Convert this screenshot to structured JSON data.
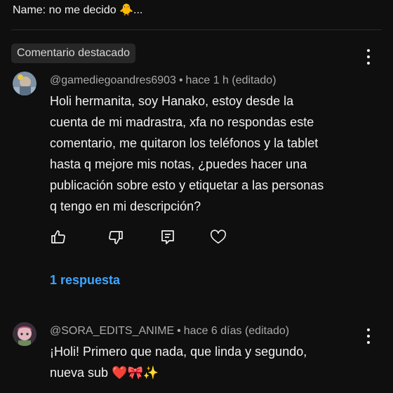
{
  "top": {
    "name_line": "Name: no me decido 🐥..."
  },
  "pinned_badge": "Comentario destacado",
  "comments": [
    {
      "author": "@gamediegoandres6903",
      "time": "hace 1 h (editado)",
      "lines": [
        "Holi hermanita, soy Hanako, estoy desde la",
        "cuenta de mi madrastra, xfa no respondas este",
        "comentario, me quitaron los teléfonos y la tablet",
        "hasta q mejore mis notas, ¿puedes hacer una",
        "publicación sobre esto y etiquetar a las personas",
        "q tengo en mi descripción?"
      ],
      "reply_link": "1 respuesta"
    },
    {
      "author": "@SORA_EDITS_ANIME",
      "time": "hace 6 días (editado)",
      "lines": [
        "¡Holi! Primero que nada, que linda y segundo,",
        "nueva sub ❤️🎀✨"
      ]
    }
  ],
  "separator": "•",
  "icons": {
    "like": "thumbs-up-icon",
    "dislike": "thumbs-down-icon",
    "reply": "comment-icon",
    "heart": "heart-icon",
    "menu": "more-vert-icon"
  },
  "colors": {
    "background": "#0f0f0f",
    "text": "#f1f1f1",
    "meta": "#aaaaaa",
    "link": "#3ea6ff",
    "badge_bg": "#272727"
  }
}
